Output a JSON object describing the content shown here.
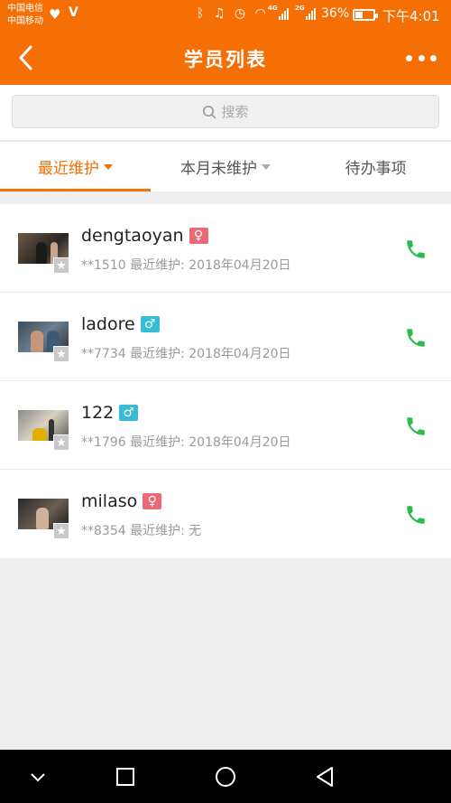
{
  "status_bar": {
    "carrier_1": "中国电信",
    "carrier_2": "中国移动",
    "net_1": "4G",
    "net_2": "2G",
    "battery": "36%",
    "battery_level": 0.36,
    "time": "下午4:01"
  },
  "header": {
    "title": "学员列表",
    "back_icon": "chevron-left-icon",
    "more_icon": "more-dots-icon"
  },
  "search": {
    "placeholder": "搜索"
  },
  "tabs": [
    {
      "label": "最近维护",
      "active": true,
      "has_caret": true
    },
    {
      "label": "本月未维护",
      "active": false,
      "has_caret": true
    },
    {
      "label": "待办事项",
      "active": false,
      "has_caret": false
    }
  ],
  "members": [
    {
      "name": "dengtaoyan",
      "gender": "female",
      "gender_symbol": "♀",
      "phone_suffix": "**1510",
      "label": "最近维护:",
      "last_maintained": "2018年04月20日"
    },
    {
      "name": "ladore",
      "gender": "male",
      "gender_symbol": "♂",
      "phone_suffix": "**7734",
      "label": "最近维护:",
      "last_maintained": "2018年04月20日"
    },
    {
      "name": "122",
      "gender": "male",
      "gender_symbol": "♂",
      "phone_suffix": "**1796",
      "label": "最近维护:",
      "last_maintained": "2018年04月20日"
    },
    {
      "name": "milaso",
      "gender": "female",
      "gender_symbol": "♀",
      "phone_suffix": "**8354",
      "label": "最近维护:",
      "last_maintained": "无"
    }
  ],
  "colors": {
    "accent": "#f56f05",
    "female": "#ec6a76",
    "male": "#35bcd6",
    "call": "#2dbb4e"
  }
}
